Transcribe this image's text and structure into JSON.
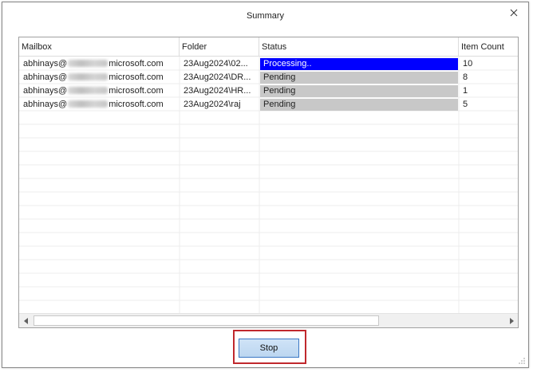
{
  "dialog": {
    "title": "Summary",
    "stop_label": "Stop"
  },
  "table": {
    "columns": [
      "Mailbox",
      "Folder",
      "Status",
      "Item Count"
    ],
    "rows": [
      {
        "mailbox_user": "abhinays@",
        "mailbox_domain": "microsoft.com",
        "folder": "23Aug2024\\02...",
        "status": "Processing..",
        "count": "10"
      },
      {
        "mailbox_user": "abhinays@",
        "mailbox_domain": "microsoft.com",
        "folder": "23Aug2024\\DR...",
        "status": "Pending",
        "count": "8"
      },
      {
        "mailbox_user": "abhinays@",
        "mailbox_domain": "microsoft.com",
        "folder": "23Aug2024\\HR...",
        "status": "Pending",
        "count": "1"
      },
      {
        "mailbox_user": "abhinays@",
        "mailbox_domain": "microsoft.com",
        "folder": "23Aug2024\\raj",
        "status": "Pending",
        "count": "5"
      }
    ]
  },
  "colors": {
    "processing": "#0000ff",
    "pending": "#c8c8c8",
    "highlight": "#c0282d",
    "button_border": "#3b78c4"
  },
  "icons": {
    "close": "close-icon",
    "scroll_left": "chevron-left-icon",
    "scroll_right": "chevron-right-icon",
    "resize": "resize-grip-icon"
  }
}
